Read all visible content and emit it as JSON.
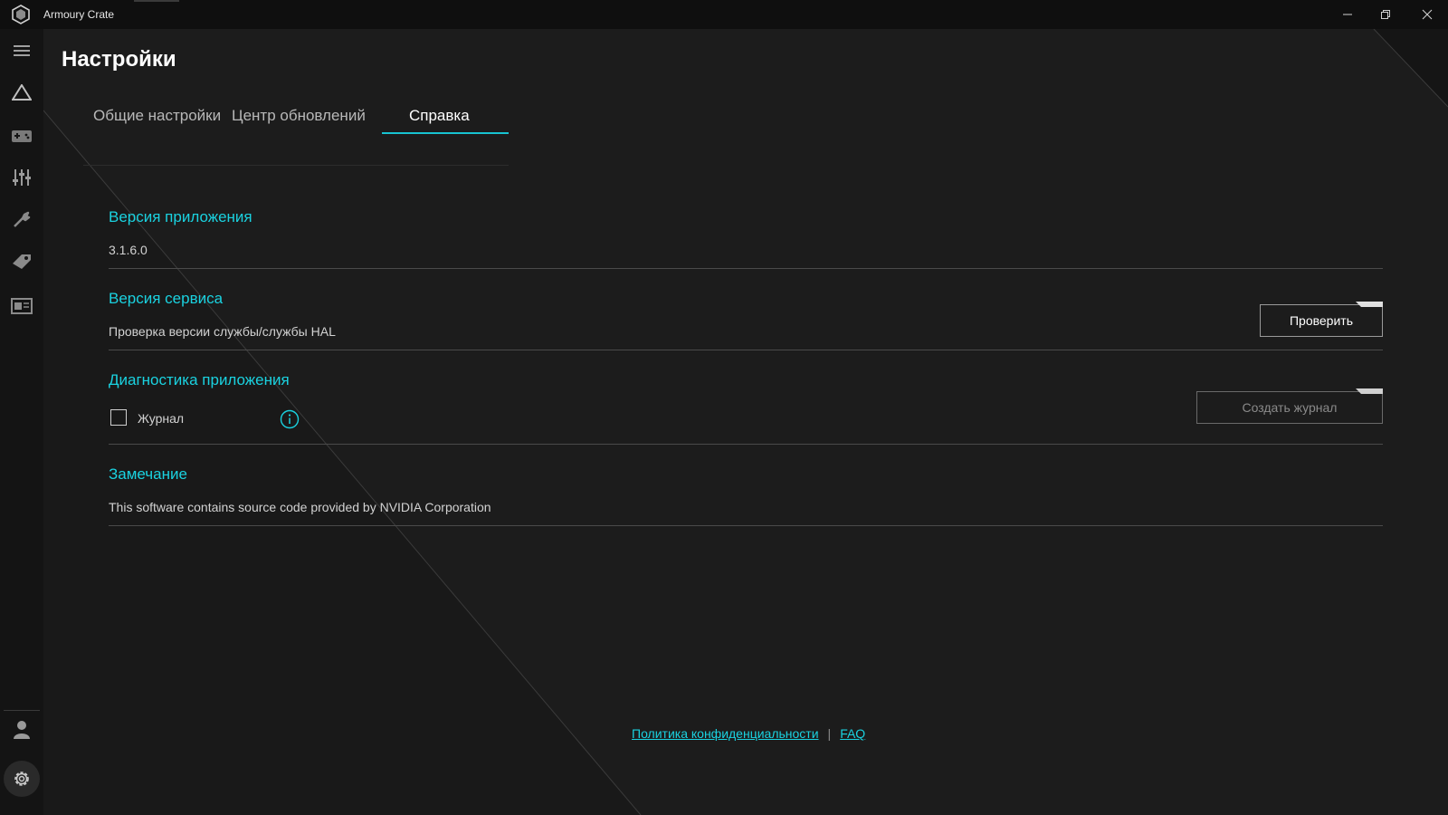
{
  "window": {
    "app_title": "Armoury Crate",
    "controls": [
      "minimize-icon",
      "restore-icon",
      "close-icon"
    ]
  },
  "sidebar": {
    "items": [
      {
        "name": "menu",
        "icon": "hamburger-menu-icon"
      },
      {
        "name": "home",
        "icon": "rog-triangle-icon"
      },
      {
        "name": "device",
        "icon": "gamepad-icon"
      },
      {
        "name": "system",
        "icon": "sliders-icon"
      },
      {
        "name": "tools",
        "icon": "wrench-icon"
      },
      {
        "name": "deals",
        "icon": "tag-icon"
      },
      {
        "name": "news",
        "icon": "news-icon"
      }
    ],
    "bottom_items": [
      {
        "name": "user",
        "icon": "user-icon"
      },
      {
        "name": "settings",
        "icon": "gear-icon"
      }
    ]
  },
  "page": {
    "title": "Настройки",
    "tabs": [
      {
        "label": "Общие настройки",
        "active": false
      },
      {
        "label": "Центр обновлений",
        "active": false
      },
      {
        "label": "Справка",
        "active": true
      }
    ]
  },
  "sections": {
    "app_version": {
      "heading": "Версия приложения",
      "value": "3.1.6.0"
    },
    "service_version": {
      "heading": "Версия сервиса",
      "desc": "Проверка версии службы/службы HAL",
      "button_label": "Проверить"
    },
    "diagnostics": {
      "heading": "Диагностика приложения",
      "checkbox_label": "Журнал",
      "checkbox_checked": false,
      "button_label": "Создать журнал",
      "button_enabled": false
    },
    "notice": {
      "heading": "Замечание",
      "desc": "This software contains source code provided by NVIDIA Corporation"
    }
  },
  "footer": {
    "privacy_link": "Политика конфиденциальности",
    "separator": "|",
    "faq_link": "FAQ"
  },
  "colors": {
    "accent": "#1ad2e0",
    "background": "#1c1c1c",
    "sidebar": "#141414",
    "titlebar": "#0f0f0f"
  }
}
